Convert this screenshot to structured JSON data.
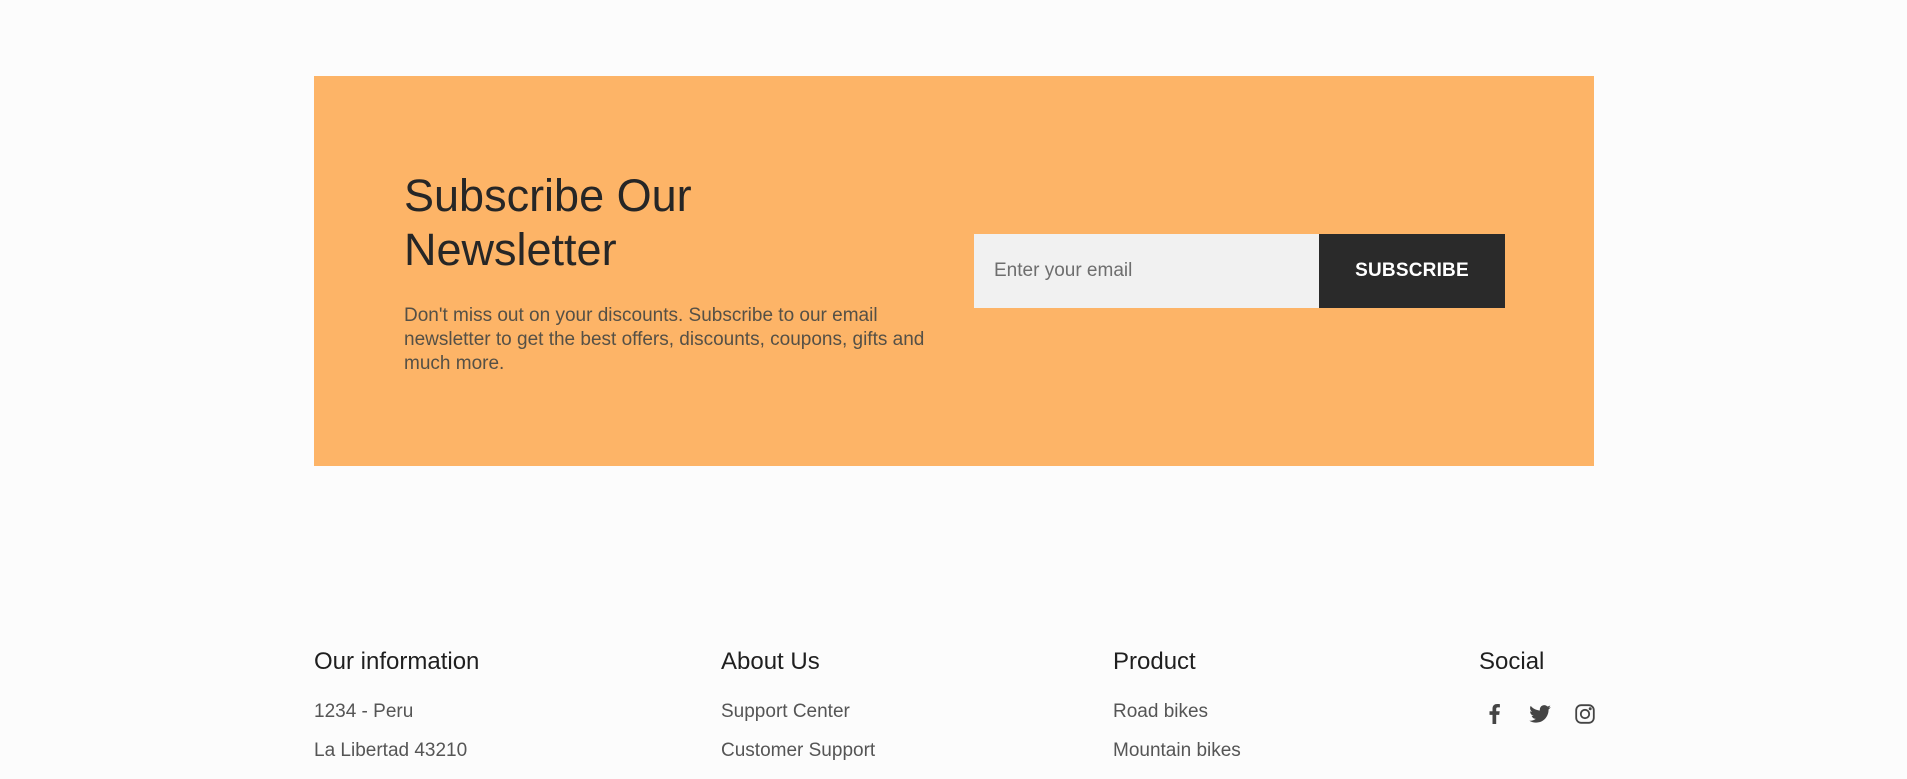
{
  "newsletter": {
    "title": "Subscribe Our Newsletter",
    "description": "Don't miss out on your discounts. Subscribe to our email newsletter to get the best offers, discounts, coupons, gifts and much more.",
    "email_placeholder": "Enter your email",
    "subscribe_label": "SUBSCRIBE",
    "background_color": "#fdb467",
    "button_color": "#2a2a2a"
  },
  "footer": {
    "columns": [
      {
        "heading": "Our information",
        "items": [
          "1234 - Peru",
          "La Libertad 43210"
        ]
      },
      {
        "heading": "About Us",
        "items": [
          "Support Center",
          "Customer Support"
        ]
      },
      {
        "heading": "Product",
        "items": [
          "Road bikes",
          "Mountain bikes"
        ]
      },
      {
        "heading": "Social",
        "icons": [
          "facebook-icon",
          "twitter-icon",
          "instagram-icon"
        ]
      }
    ]
  }
}
